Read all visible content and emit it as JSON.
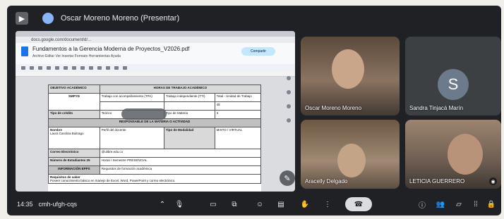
{
  "meeting": {
    "presenting_title": "Oscar Moreno Moreno (Presentar)",
    "time": "14:35",
    "code": "cmh-ufgh-cqs"
  },
  "shared_doc": {
    "url": "docs.google.com/document/d/...",
    "title": "Fundamentos a la Gerencia Moderna de Proyectos_V2026.pdf",
    "menu": "Archivo  Editar  Ver  Insertar  Formato  Herramientas  Ayuda",
    "share_label": "Compartir",
    "form": {
      "r1c1": "OBJETIVO ACADÉMICO",
      "r1c2": "HORAS DE TRABAJO ACADÉMICO",
      "r2c2": "Trabajo con acompañamiento (TPA)",
      "r2c3": "Trabajo independiente (TTI)",
      "r2c4": "Total - Unidad de Trabajo",
      "r3c1": "SMPYD",
      "r3c4": "48",
      "r4c1": "Tipo de crédito",
      "r4c2": "Teórico",
      "r4c3": "Tipo de Materia",
      "r4c4": "3",
      "section": "RESPONSABLE DE LA MATERIA O ACTIVIDAD",
      "name_label": "Nombre",
      "name_value": "Laura Carolina Buitrago",
      "profile_label": "Perfil del docente",
      "modality_label": "Tipo de Modalidad",
      "modality_value": "MIXTO / VIRTUAL",
      "email_label": "Correo Electrónico",
      "email_value": "@ulibre.edu.co",
      "students_label": "Número de Estudiantes",
      "students_value": "25",
      "schedule_label": "Horas / Semestre",
      "schedule_value": "PRESENCIAL",
      "info_label": "INFORMACIÓN EPPS",
      "info_value": "Requisitos de formación académica",
      "req_label": "Requisitos de saber",
      "req_value": "Poseer conocimiento básico en manejo de Excel, Word, PowerPoint y correo electrónico."
    }
  },
  "participants": [
    {
      "name": "Oscar Moreno Moreno",
      "type": "video"
    },
    {
      "name": "Sandra Tinjacá Marín",
      "type": "avatar",
      "initial": "S"
    },
    {
      "name": "Aracelly Delgado",
      "type": "video"
    },
    {
      "name": "LETICIA GUERRERO",
      "type": "video"
    }
  ],
  "controls": {
    "captions_icon": "captions-icon",
    "mic_icon": "microphone-icon",
    "camera_icon": "camera-icon",
    "present_icon": "present-icon",
    "emoji_icon": "emoji-icon",
    "hand_icon": "raise-hand-icon",
    "more_icon": "more-vert-icon",
    "hangup_icon": "hangup-icon",
    "info_icon": "info-icon",
    "people_icon": "people-icon",
    "chat_icon": "chat-icon",
    "activities_icon": "activities-icon",
    "lock_icon": "lock-icon"
  },
  "colors": {
    "background": "#202124",
    "hangup": "#dadce0",
    "share_button": "#c2e7ff"
  }
}
